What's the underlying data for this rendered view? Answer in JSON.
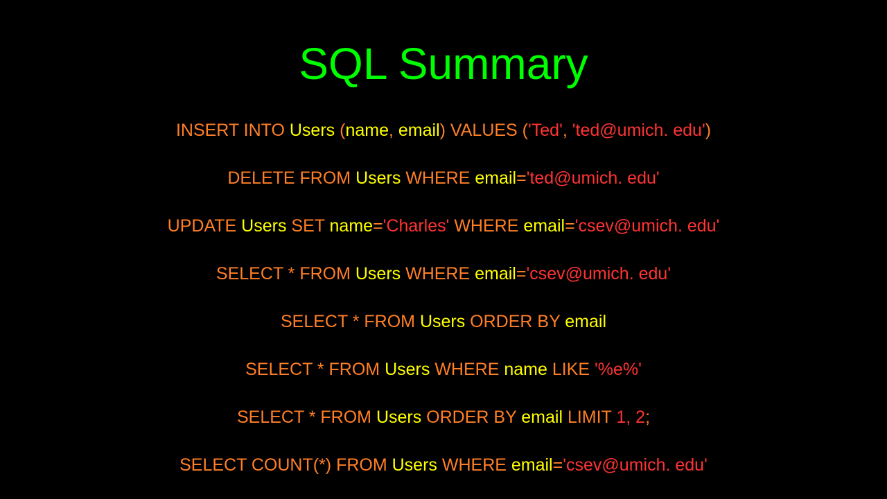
{
  "title": "SQL Summary",
  "statements": [
    {
      "parts": [
        {
          "cls": "kw",
          "text": "INSERT INTO "
        },
        {
          "cls": "id",
          "text": "Users"
        },
        {
          "cls": "kw",
          "text": " ("
        },
        {
          "cls": "id",
          "text": "name"
        },
        {
          "cls": "kw",
          "text": ", "
        },
        {
          "cls": "id",
          "text": "email"
        },
        {
          "cls": "kw",
          "text": ") VALUES ("
        },
        {
          "cls": "lit",
          "text": "'Ted'"
        },
        {
          "cls": "kw",
          "text": ", "
        },
        {
          "cls": "lit",
          "text": "'ted@umich. edu'"
        },
        {
          "cls": "kw",
          "text": ")"
        }
      ]
    },
    {
      "parts": [
        {
          "cls": "kw",
          "text": "DELETE FROM "
        },
        {
          "cls": "id",
          "text": "Users"
        },
        {
          "cls": "kw",
          "text": " WHERE "
        },
        {
          "cls": "id",
          "text": "email"
        },
        {
          "cls": "kw",
          "text": "="
        },
        {
          "cls": "lit",
          "text": "'ted@umich. edu'"
        }
      ]
    },
    {
      "parts": [
        {
          "cls": "kw",
          "text": "UPDATE "
        },
        {
          "cls": "id",
          "text": "Users"
        },
        {
          "cls": "kw",
          "text": " SET "
        },
        {
          "cls": "id",
          "text": "name"
        },
        {
          "cls": "kw",
          "text": "="
        },
        {
          "cls": "lit",
          "text": "'Charles'"
        },
        {
          "cls": "kw",
          "text": " WHERE "
        },
        {
          "cls": "id",
          "text": "email"
        },
        {
          "cls": "kw",
          "text": "="
        },
        {
          "cls": "lit",
          "text": "'csev@umich. edu'"
        }
      ]
    },
    {
      "parts": [
        {
          "cls": "kw",
          "text": "SELECT * FROM "
        },
        {
          "cls": "id",
          "text": "Users"
        },
        {
          "cls": "kw",
          "text": " WHERE "
        },
        {
          "cls": "id",
          "text": "email"
        },
        {
          "cls": "kw",
          "text": "="
        },
        {
          "cls": "lit",
          "text": "'csev@umich. edu'"
        }
      ]
    },
    {
      "parts": [
        {
          "cls": "kw",
          "text": "SELECT * FROM "
        },
        {
          "cls": "id",
          "text": "Users"
        },
        {
          "cls": "kw",
          "text": " ORDER BY "
        },
        {
          "cls": "id",
          "text": "email"
        }
      ]
    },
    {
      "parts": [
        {
          "cls": "kw",
          "text": "SELECT * FROM "
        },
        {
          "cls": "id",
          "text": "Users"
        },
        {
          "cls": "kw",
          "text": " WHERE "
        },
        {
          "cls": "id",
          "text": "name"
        },
        {
          "cls": "kw",
          "text": " LIKE "
        },
        {
          "cls": "lit",
          "text": "'%e%'"
        }
      ]
    },
    {
      "parts": [
        {
          "cls": "kw",
          "text": "SELECT * FROM "
        },
        {
          "cls": "id",
          "text": "Users"
        },
        {
          "cls": "kw",
          "text": " ORDER BY "
        },
        {
          "cls": "id",
          "text": "email"
        },
        {
          "cls": "kw",
          "text": " LIMIT "
        },
        {
          "cls": "lit",
          "text": "1, 2"
        },
        {
          "cls": "kw",
          "text": ";"
        }
      ]
    },
    {
      "parts": [
        {
          "cls": "kw",
          "text": "SELECT COUNT(*) FROM "
        },
        {
          "cls": "id",
          "text": "Users"
        },
        {
          "cls": "kw",
          "text": " WHERE "
        },
        {
          "cls": "id",
          "text": "email"
        },
        {
          "cls": "kw",
          "text": "="
        },
        {
          "cls": "lit",
          "text": "'csev@umich. edu'"
        }
      ]
    }
  ]
}
